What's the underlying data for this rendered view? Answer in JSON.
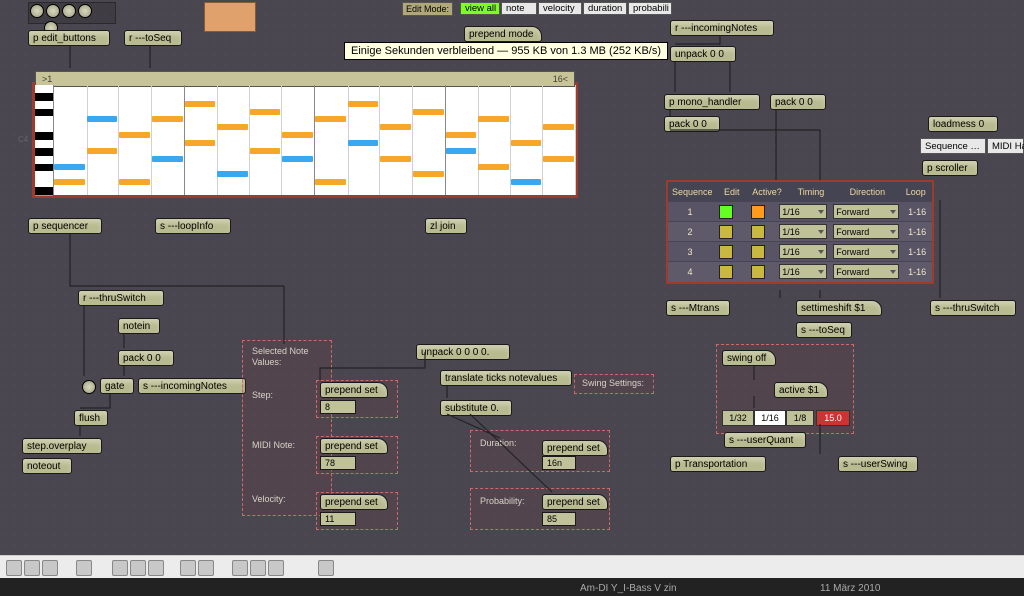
{
  "header": {
    "editMode": "Edit Mode:",
    "tabs": [
      "view all",
      "note",
      "velocity",
      "duration",
      "probabili"
    ],
    "prependMode": "prepend mode",
    "tooltip": "Einige Sekunden verbleibend — 955 KB von 1.3 MB (252 KB/s)"
  },
  "topRow": {
    "editButtons": "p edit_buttons",
    "rToSeq": "r ---toSeq",
    "rIncomingNotes": "r ---incomingNotes",
    "unpack00a": "unpack 0 0",
    "pMonoHandler": "p mono_handler",
    "pack00a": "pack 0 0",
    "loadmess0": "loadmess 0",
    "sequenceTab": "Sequence …",
    "midiHaTab": "MIDI Ha",
    "pScroller": "p scroller"
  },
  "seq": {
    "hdrL": ">1",
    "hdrR": "16<",
    "c4": "C4",
    "cols": 16,
    "notes": [
      {
        "c": 0,
        "r": 12,
        "k": "o"
      },
      {
        "c": 0,
        "r": 10,
        "k": "b"
      },
      {
        "c": 1,
        "r": 8,
        "k": "o"
      },
      {
        "c": 1,
        "r": 4,
        "k": "b"
      },
      {
        "c": 2,
        "r": 6,
        "k": "o"
      },
      {
        "c": 2,
        "r": 12,
        "k": "o"
      },
      {
        "c": 3,
        "r": 4,
        "k": "o"
      },
      {
        "c": 3,
        "r": 9,
        "k": "b"
      },
      {
        "c": 4,
        "r": 7,
        "k": "o"
      },
      {
        "c": 4,
        "r": 2,
        "k": "o"
      },
      {
        "c": 5,
        "r": 5,
        "k": "o"
      },
      {
        "c": 5,
        "r": 11,
        "k": "b"
      },
      {
        "c": 6,
        "r": 8,
        "k": "o"
      },
      {
        "c": 6,
        "r": 3,
        "k": "o"
      },
      {
        "c": 7,
        "r": 6,
        "k": "o"
      },
      {
        "c": 7,
        "r": 9,
        "k": "b"
      },
      {
        "c": 8,
        "r": 4,
        "k": "o"
      },
      {
        "c": 8,
        "r": 12,
        "k": "o"
      },
      {
        "c": 9,
        "r": 7,
        "k": "b"
      },
      {
        "c": 9,
        "r": 2,
        "k": "o"
      },
      {
        "c": 10,
        "r": 9,
        "k": "o"
      },
      {
        "c": 10,
        "r": 5,
        "k": "o"
      },
      {
        "c": 11,
        "r": 3,
        "k": "o"
      },
      {
        "c": 11,
        "r": 11,
        "k": "o"
      },
      {
        "c": 12,
        "r": 6,
        "k": "o"
      },
      {
        "c": 12,
        "r": 8,
        "k": "b"
      },
      {
        "c": 13,
        "r": 4,
        "k": "o"
      },
      {
        "c": 13,
        "r": 10,
        "k": "o"
      },
      {
        "c": 14,
        "r": 7,
        "k": "o"
      },
      {
        "c": 14,
        "r": 12,
        "k": "b"
      },
      {
        "c": 15,
        "r": 5,
        "k": "o"
      },
      {
        "c": 15,
        "r": 9,
        "k": "o"
      }
    ]
  },
  "below": {
    "pSequencer": "p sequencer",
    "sLoopInfo": "s ---loopInfo",
    "zlJoin": "zl join",
    "pack00b": "pack 0 0"
  },
  "leftChain": {
    "rThru": "r ---thruSwitch",
    "notein": "notein",
    "pack00": "pack 0 0",
    "gate": "gate",
    "sIncoming": "s ---incomingNotes",
    "flush": "flush",
    "overplay": "step.overplay",
    "noteout": "noteout"
  },
  "selPanel": {
    "title": "Selected Note\nValues:",
    "step": "Step:",
    "stepV": "8",
    "midi": "MIDI Note:",
    "midiV": "78",
    "vel": "Velocity:",
    "velV": "11"
  },
  "midChain": {
    "unpack": "unpack 0 0 0 0.",
    "prep1": "prepend set",
    "prep2": "prepend set",
    "prep3": "prepend set",
    "translate": "translate ticks notevalues",
    "sub0": "substitute 0.",
    "swingSettings": "Swing Settings:",
    "duration": "Duration:",
    "durV": "16n",
    "prob": "Probability:",
    "probV": "85",
    "prep4": "prepend set",
    "prep5": "prepend set"
  },
  "table": {
    "headers": [
      "Sequence",
      "Edit",
      "Active?",
      "Timing",
      "Direction",
      "Loop"
    ],
    "rows": [
      {
        "seq": "1",
        "edit": "g",
        "active": "o",
        "timing": "1/16",
        "dir": "Forward",
        "loop": "1-16"
      },
      {
        "seq": "2",
        "edit": "y",
        "active": "y",
        "timing": "1/16",
        "dir": "Forward",
        "loop": "1-16"
      },
      {
        "seq": "3",
        "edit": "y",
        "active": "y",
        "timing": "1/16",
        "dir": "Forward",
        "loop": "1-16"
      },
      {
        "seq": "4",
        "edit": "y",
        "active": "y",
        "timing": "1/16",
        "dir": "Forward",
        "loop": "1-16"
      }
    ]
  },
  "rightChain": {
    "sMtrans": "s ---Mtrans",
    "settime": "settimeshift $1",
    "sToSeq": "s ---toSeq",
    "sThru": "s ---thruSwitch"
  },
  "swing": {
    "swingOff": "swing off",
    "active": "active $1",
    "opts": [
      "1/32",
      "1/16",
      "1/8"
    ],
    "amt": "15.0",
    "sUserQuant": "s ---userQuant",
    "pTransport": "p Transportation",
    "sUserSwing": "s ---userSwing"
  },
  "footer": {
    "file": "Am-DI Y_I-Bass V zin",
    "date": "11 März 2010"
  }
}
